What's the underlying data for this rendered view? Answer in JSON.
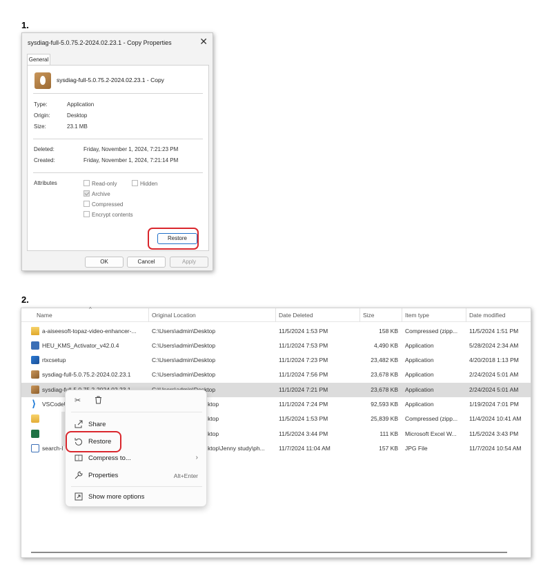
{
  "steps": {
    "one": "1.",
    "two": "2."
  },
  "dialog": {
    "title": "sysdiag-full-5.0.75.2-2024.02.23.1 - Copy Properties",
    "tab": "General",
    "file_name": "sysdiag-full-5.0.75.2-2024.02.23.1 - Copy",
    "type_label": "Type:",
    "type_value": "Application",
    "origin_label": "Origin:",
    "origin_value": "Desktop",
    "size_label": "Size:",
    "size_value": "23.1 MB",
    "deleted_label": "Deleted:",
    "deleted_value": "Friday, November 1, 2024, 7:21:23 PM",
    "created_label": "Created:",
    "created_value": "Friday, November 1, 2024, 7:21:14 PM",
    "attributes_label": "Attributes",
    "attributes": {
      "read_only": "Read-only",
      "hidden": "Hidden",
      "archive": "Archive",
      "compressed": "Compressed",
      "encrypt": "Encrypt contents"
    },
    "restore_button": "Restore",
    "ok_button": "OK",
    "cancel_button": "Cancel",
    "apply_button": "Apply"
  },
  "recycle_bin": {
    "columns": {
      "name": "Name",
      "original_location": "Original Location",
      "date_deleted": "Date Deleted",
      "size": "Size",
      "item_type": "Item type",
      "date_modified": "Date modified"
    },
    "rows": [
      {
        "name": "a-aiseesoft-topaz-video-enhancer-...",
        "location": "C:\\Users\\admin\\Desktop",
        "deleted": "11/5/2024 1:53 PM",
        "size": "158 KB",
        "type": "Compressed (zipp...",
        "modified": "11/5/2024 1:51 PM",
        "icon": "zip-folder-icon"
      },
      {
        "name": "HEU_KMS_Activator_v42.0.4",
        "location": "C:\\Users\\admin\\Desktop",
        "deleted": "11/1/2024 7:53 PM",
        "size": "4,490 KB",
        "type": "Application",
        "modified": "5/28/2024 2:34 AM",
        "icon": "application-icon"
      },
      {
        "name": "rtxcsetup",
        "location": "C:\\Users\\admin\\Desktop",
        "deleted": "11/1/2024 7:23 PM",
        "size": "23,482 KB",
        "type": "Application",
        "modified": "4/20/2018 1:13 PM",
        "icon": "setup-icon"
      },
      {
        "name": "sysdiag-full-5.0.75.2-2024.02.23.1",
        "location": "C:\\Users\\admin\\Desktop",
        "deleted": "11/1/2024 7:56 PM",
        "size": "23,678 KB",
        "type": "Application",
        "modified": "2/24/2024 5:01 AM",
        "icon": "sysdiag-icon"
      },
      {
        "name": "sysdiag-full-5.0.75.2-2024.02.23.1...",
        "location": "C:\\Users\\admin\\Desktop",
        "deleted": "11/1/2024 7:21 PM",
        "size": "23,678 KB",
        "type": "Application",
        "modified": "2/24/2024 5:01 AM",
        "icon": "sysdiag-icon"
      },
      {
        "name": "VSCodeU",
        "location": "ktop",
        "deleted": "11/1/2024 7:24 PM",
        "size": "92,593 KB",
        "type": "Application",
        "modified": "1/19/2024 7:01 PM",
        "icon": "vscode-icon"
      },
      {
        "name": "",
        "location": "ktop",
        "deleted": "11/5/2024 1:53 PM",
        "size": "25,839 KB",
        "type": "Compressed (zipp...",
        "modified": "11/4/2024 10:41 AM",
        "icon": "folder-icon"
      },
      {
        "name": "",
        "location": "ktop",
        "deleted": "11/5/2024 3:44 PM",
        "size": "111 KB",
        "type": "Microsoft Excel W...",
        "modified": "11/5/2024 3:43 PM",
        "icon": "excel-icon"
      },
      {
        "name": "search-l",
        "location": "ktop\\Jenny study\\ph...",
        "deleted": "11/7/2024 11:04 AM",
        "size": "157 KB",
        "type": "JPG File",
        "modified": "11/7/2024 10:54 AM",
        "icon": "image-icon"
      }
    ]
  },
  "context_menu": {
    "cut_icon": "✂",
    "delete_icon": "🗑",
    "share": "Share",
    "restore": "Restore",
    "compress": "Compress to...",
    "properties": "Properties",
    "properties_shortcut": "Alt+Enter",
    "more_options": "Show more options"
  },
  "colors": {
    "highlight_ring": "#d9262c",
    "selected_row": "#dcdcdc",
    "accent": "#1f6fc9"
  }
}
